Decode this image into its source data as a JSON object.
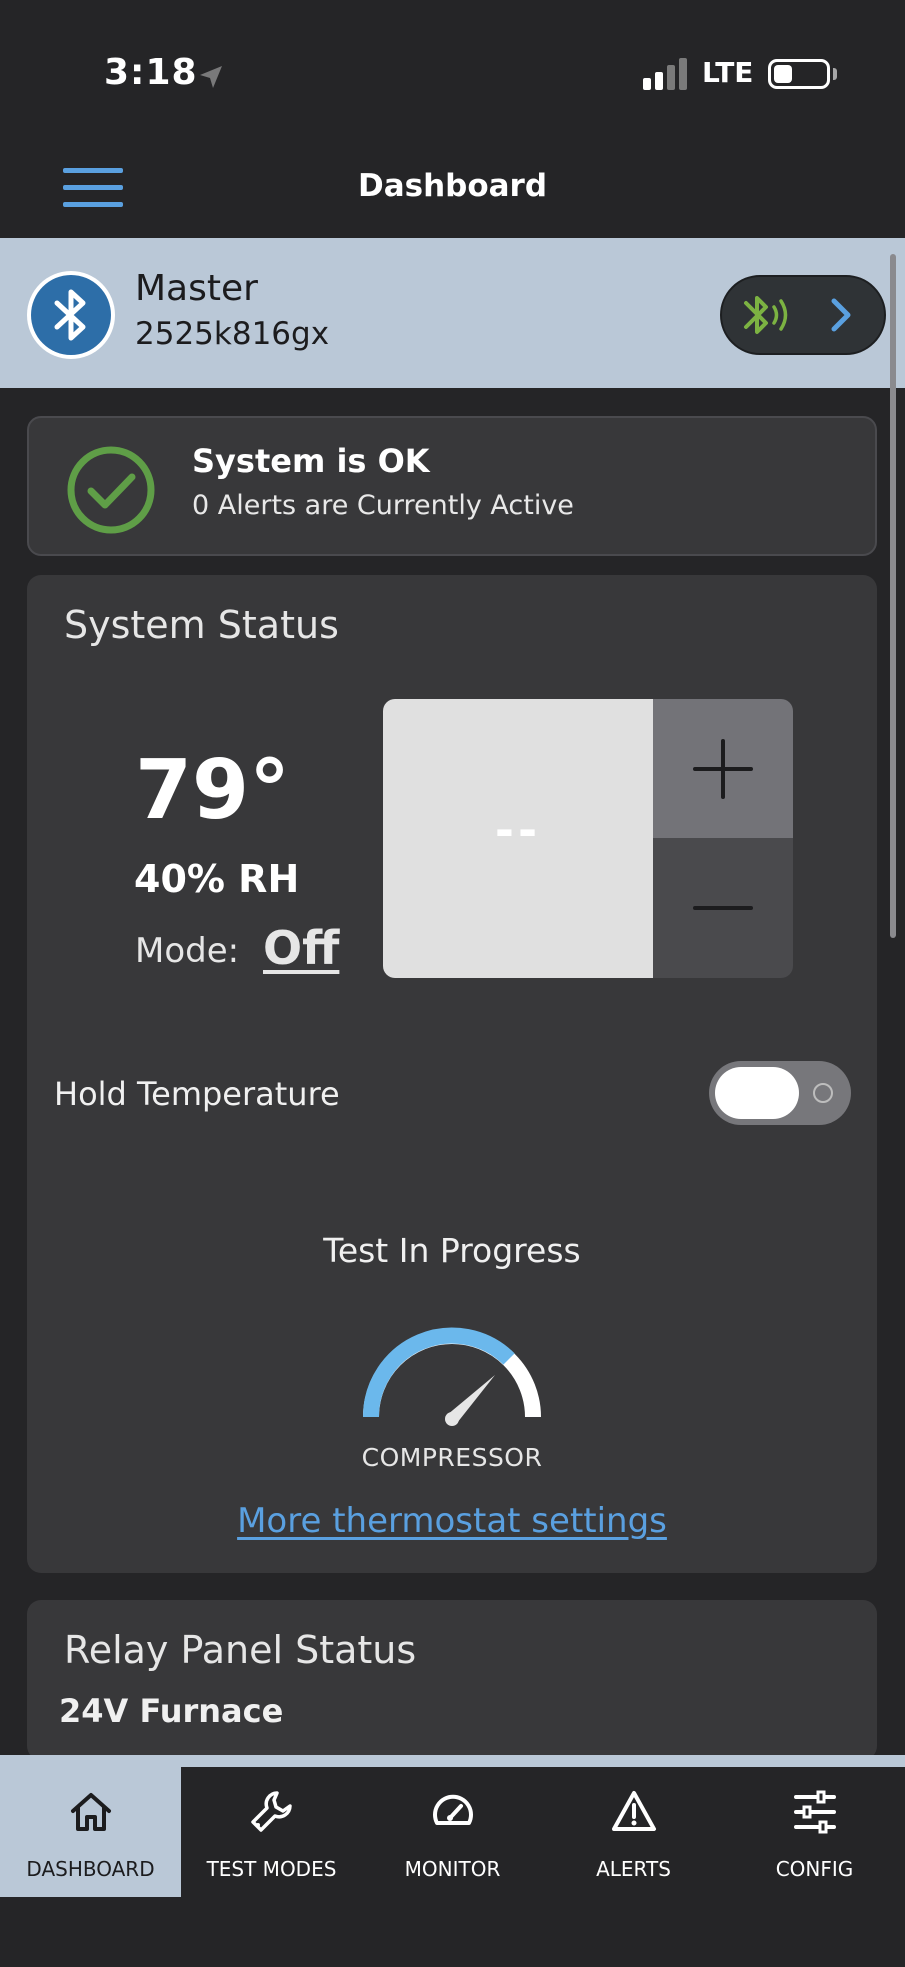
{
  "status_bar": {
    "time": "3:18",
    "network": "LTE"
  },
  "header": {
    "title": "Dashboard"
  },
  "device": {
    "name": "Master",
    "id": "2525k816gx"
  },
  "system_ok": {
    "title": "System is OK",
    "subtitle": "0 Alerts are Currently Active"
  },
  "system_status": {
    "title": "System Status",
    "temperature": "79°",
    "humidity": "40% RH",
    "mode_label": "Mode:",
    "mode_value": "Off",
    "setpoint": "--",
    "hold_label": "Hold Temperature",
    "hold_enabled": true,
    "test_label": "Test In Progress",
    "gauge_label": "COMPRESSOR",
    "more_link": "More thermostat settings"
  },
  "relay_panel": {
    "title": "Relay Panel Status",
    "first_item": "24V Furnace"
  },
  "bottom_nav": {
    "items": [
      {
        "label": "DASHBOARD",
        "icon": "home-icon",
        "active": true
      },
      {
        "label": "TEST MODES",
        "icon": "wrench-icon",
        "active": false
      },
      {
        "label": "MONITOR",
        "icon": "gauge-icon",
        "active": false
      },
      {
        "label": "ALERTS",
        "icon": "warning-icon",
        "active": false
      },
      {
        "label": "CONFIG",
        "icon": "sliders-icon",
        "active": false
      }
    ]
  },
  "colors": {
    "accent": "#5aa0e0",
    "ok_green": "#5f9e47",
    "bluetooth_green": "#7cb342",
    "device_bar": "#bac8d7",
    "card": "#38383a",
    "background": "#252527"
  }
}
